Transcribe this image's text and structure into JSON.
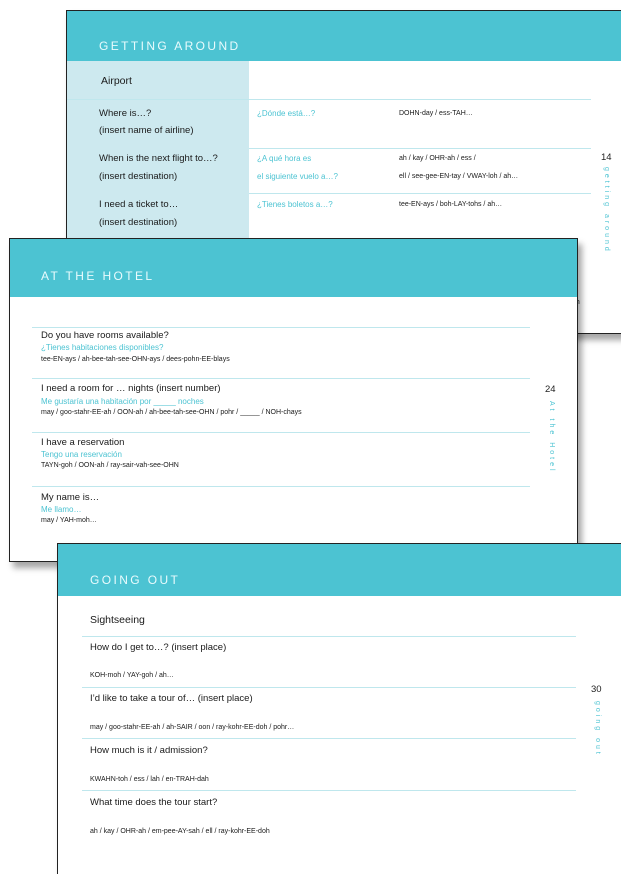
{
  "p1": {
    "title": "GETTING AROUND",
    "page_number": "14",
    "side_label": "getting around",
    "section": "Airport",
    "rows": [
      {
        "en1": "Where is…?",
        "en2": "(insert name of airline)",
        "es1": "¿Dónde está…?",
        "es2": "",
        "ph1": "DOHN-day / ess-TAH…",
        "ph2": ""
      },
      {
        "en1": "When is the next flight to…?",
        "en2": "(insert destination)",
        "es1": "¿A qué hora es",
        "es2": "el siguiente vuelo a…?",
        "ph1": "ah / kay / OHR-ah / ess /",
        "ph2": "ell / see-gee-EN-tay / VWAY-loh / ah…"
      },
      {
        "en1": "I need a ticket to…",
        "en2": "(insert destination)",
        "es1": "¿Tienes boletos a…?",
        "es2": "",
        "ph1": "tee-EN-ays / boh-LAY-tohs / ah…",
        "ph2": ""
      }
    ],
    "peek": "tah"
  },
  "p2": {
    "title": "AT THE HOTEL",
    "page_number": "24",
    "side_label": "At the Hotel",
    "entries": [
      {
        "en": "Do you have rooms available?",
        "es": "¿Tienes habitaciones disponibles?",
        "ph": "tee-EN-ays / ah-bee-tah-see-OHN-ays / dees-pohn-EE-blays"
      },
      {
        "en": "I need a room for … nights (insert number)",
        "es": "Me gustaría una habitación por _____ noches",
        "ph": "may / goo-stahr-EE-ah / OON-ah / ah-bee-tah-see-OHN / pohr / _____ / NOH-chays"
      },
      {
        "en": "I have a reservation",
        "es": "Tengo una reservación",
        "ph": "TAYN-goh / OON-ah / ray-sair-vah-see-OHN"
      },
      {
        "en": "My name is…",
        "es": "Me llamo…",
        "ph": "may / YAH-moh…"
      }
    ]
  },
  "p3": {
    "title": "GOING OUT",
    "page_number": "30",
    "side_label": "going out",
    "section": "Sightseeing",
    "entries": [
      {
        "en": "How do I get to…? (insert place)",
        "ph": "KOH-moh / YAY-goh / ah…"
      },
      {
        "en": "I’d like to take a tour of… (insert place)",
        "ph": "may / goo-stahr-EE-ah / ah-SAIR / oon / ray-kohr-EE-doh / pohr…"
      },
      {
        "en": "How much is it / admission?",
        "ph": "KWAHN-toh / ess / lah / en-TRAH-dah"
      },
      {
        "en": "What time does the tour start?",
        "ph": "ah / kay / OHR-ah / em-pee-AY-sah / ell / ray-kohr-EE-doh"
      }
    ]
  }
}
